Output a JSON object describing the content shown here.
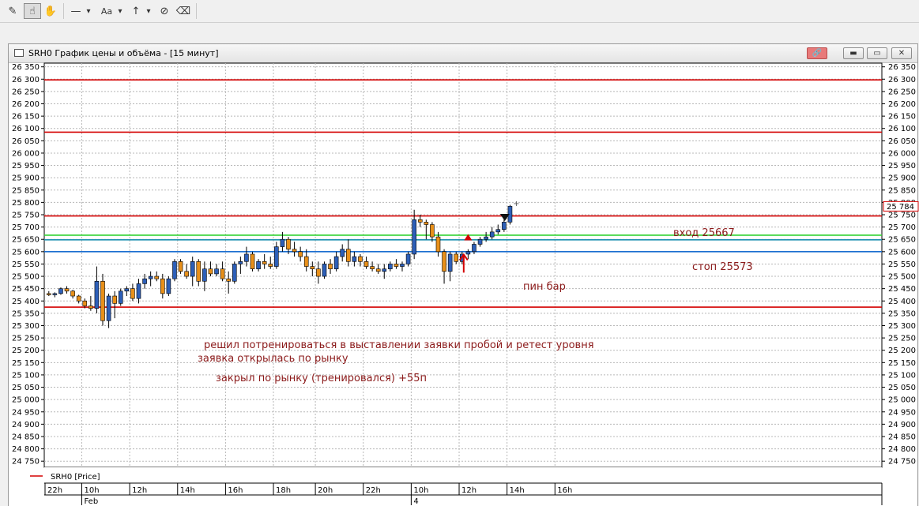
{
  "toolbar": {
    "items": [
      {
        "name": "ruler-icon",
        "glyph": "✎"
      },
      {
        "name": "hand-pointer-icon",
        "glyph": "☝"
      },
      {
        "name": "hand-grab-icon",
        "glyph": "✋"
      },
      {
        "name": "line-tool-icon",
        "glyph": "—"
      },
      {
        "name": "text-tool-icon",
        "glyph": "Aa"
      },
      {
        "name": "arrow-up-tool-icon",
        "glyph": "↑"
      },
      {
        "name": "hide-drawings-icon",
        "glyph": "⊘"
      },
      {
        "name": "erase-drawings-icon",
        "glyph": "⌫"
      }
    ],
    "dropdown_glyph": "▾"
  },
  "window": {
    "title": "SRH0 График цены и объёма - [15 минут]",
    "link_glyph": "🔗",
    "min_glyph": "▬",
    "max_glyph": "▭",
    "close_glyph": "✕"
  },
  "chart_data": {
    "type": "candlestick",
    "ylim": [
      24725,
      26365
    ],
    "ytick_step": 50,
    "y_ticks": [
      "26 350",
      "26 300",
      "26 250",
      "26 200",
      "26 150",
      "26 100",
      "26 050",
      "26 000",
      "25 950",
      "25 900",
      "25 850",
      "25 800",
      "25 750",
      "25 700",
      "25 650",
      "25 600",
      "25 550",
      "25 500",
      "25 450",
      "25 400",
      "25 350",
      "25 300",
      "25 250",
      "25 200",
      "25 150",
      "25 100",
      "25 050",
      "25 000",
      "24 950",
      "24 900",
      "24 850",
      "24 800",
      "24 750"
    ],
    "grid": true,
    "bar_count": 79,
    "x_time_labels": [
      {
        "bar": -2,
        "text": "22h"
      },
      {
        "bar": 6,
        "text": "10h"
      },
      {
        "bar": 14,
        "text": "12h"
      },
      {
        "bar": 22,
        "text": "14h"
      },
      {
        "bar": 30,
        "text": "16h"
      },
      {
        "bar": 38,
        "text": "18h"
      },
      {
        "bar": 45,
        "text": "20h"
      },
      {
        "bar": 53,
        "text": "22h"
      },
      {
        "bar": 61,
        "text": "10h"
      },
      {
        "bar": 69,
        "text": "12h"
      },
      {
        "bar": 77,
        "text": "14h"
      },
      {
        "bar": 85,
        "text": "16h"
      }
    ],
    "x_date_labels": [
      {
        "bar": 6,
        "text": "Feb"
      },
      {
        "bar": 61,
        "text": "4"
      }
    ],
    "candles": [
      [
        25430,
        25440,
        25420,
        25425
      ],
      [
        25425,
        25435,
        25415,
        25430
      ],
      [
        25430,
        25455,
        25425,
        25450
      ],
      [
        25450,
        25460,
        25430,
        25440
      ],
      [
        25440,
        25445,
        25410,
        25420
      ],
      [
        25420,
        25425,
        25390,
        25400
      ],
      [
        25400,
        25410,
        25370,
        25380
      ],
      [
        25380,
        25420,
        25360,
        25370
      ],
      [
        25370,
        25540,
        25350,
        25480
      ],
      [
        25480,
        25510,
        25300,
        25320
      ],
      [
        25320,
        25430,
        25290,
        25420
      ],
      [
        25420,
        25440,
        25330,
        25390
      ],
      [
        25390,
        25450,
        25380,
        25440
      ],
      [
        25440,
        25460,
        25420,
        25450
      ],
      [
        25450,
        25470,
        25400,
        25410
      ],
      [
        25410,
        25490,
        25390,
        25470
      ],
      [
        25470,
        25510,
        25450,
        25490
      ],
      [
        25490,
        25520,
        25460,
        25500
      ],
      [
        25500,
        25520,
        25480,
        25490
      ],
      [
        25490,
        25510,
        25410,
        25430
      ],
      [
        25430,
        25500,
        25420,
        25490
      ],
      [
        25490,
        25570,
        25480,
        25560
      ],
      [
        25560,
        25570,
        25510,
        25520
      ],
      [
        25520,
        25550,
        25490,
        25500
      ],
      [
        25500,
        25580,
        25460,
        25560
      ],
      [
        25560,
        25570,
        25460,
        25480
      ],
      [
        25480,
        25560,
        25440,
        25530
      ],
      [
        25530,
        25560,
        25500,
        25510
      ],
      [
        25510,
        25550,
        25500,
        25530
      ],
      [
        25530,
        25560,
        25480,
        25490
      ],
      [
        25490,
        25520,
        25430,
        25480
      ],
      [
        25480,
        25560,
        25470,
        25550
      ],
      [
        25550,
        25580,
        25510,
        25560
      ],
      [
        25560,
        25620,
        25540,
        25590
      ],
      [
        25590,
        25600,
        25520,
        25530
      ],
      [
        25530,
        25570,
        25520,
        25560
      ],
      [
        25560,
        25590,
        25530,
        25550
      ],
      [
        25550,
        25580,
        25530,
        25540
      ],
      [
        25540,
        25640,
        25530,
        25620
      ],
      [
        25620,
        25680,
        25600,
        25650
      ],
      [
        25650,
        25660,
        25590,
        25610
      ],
      [
        25610,
        25640,
        25580,
        25600
      ],
      [
        25600,
        25620,
        25560,
        25580
      ],
      [
        25580,
        25610,
        25520,
        25540
      ],
      [
        25540,
        25560,
        25500,
        25530
      ],
      [
        25530,
        25560,
        25470,
        25500
      ],
      [
        25500,
        25560,
        25490,
        25550
      ],
      [
        25550,
        25570,
        25510,
        25530
      ],
      [
        25530,
        25600,
        25520,
        25580
      ],
      [
        25580,
        25630,
        25560,
        25610
      ],
      [
        25610,
        25650,
        25540,
        25560
      ],
      [
        25560,
        25600,
        25540,
        25580
      ],
      [
        25580,
        25590,
        25540,
        25560
      ],
      [
        25560,
        25580,
        25530,
        25540
      ],
      [
        25540,
        25560,
        25520,
        25530
      ],
      [
        25530,
        25550,
        25510,
        25520
      ],
      [
        25520,
        25550,
        25490,
        25530
      ],
      [
        25530,
        25560,
        25520,
        25550
      ],
      [
        25550,
        25570,
        25530,
        25540
      ],
      [
        25540,
        25560,
        25520,
        25550
      ],
      [
        25550,
        25600,
        25540,
        25590
      ],
      [
        25590,
        25770,
        25570,
        25730
      ],
      [
        25730,
        25750,
        25700,
        25720
      ],
      [
        25720,
        25730,
        25650,
        25710
      ],
      [
        25710,
        25720,
        25640,
        25660
      ],
      [
        25660,
        25680,
        25580,
        25600
      ],
      [
        25600,
        25610,
        25470,
        25520
      ],
      [
        25520,
        25600,
        25480,
        25590
      ],
      [
        25590,
        25600,
        25550,
        25560
      ],
      [
        25560,
        25600,
        25550,
        25590
      ],
      [
        25590,
        25610,
        25570,
        25600
      ],
      [
        25600,
        25640,
        25590,
        25630
      ],
      [
        25630,
        25660,
        25620,
        25650
      ],
      [
        25650,
        25680,
        25640,
        25660
      ],
      [
        25660,
        25700,
        25650,
        25680
      ],
      [
        25680,
        25710,
        25670,
        25690
      ]
    ],
    "current_price": "25 784",
    "level_lines": [
      {
        "price": 26297,
        "color": "#d40000"
      },
      {
        "price": 26085,
        "color": "#d40000"
      },
      {
        "price": 25745,
        "color": "#d40000"
      },
      {
        "price": 25667,
        "color": "#2fd22f"
      },
      {
        "price": 25648,
        "color": "#1e90b0"
      },
      {
        "price": 25600,
        "color": "#1a6ed0"
      },
      {
        "price": 25375,
        "color": "#d40000"
      }
    ],
    "colors": {
      "up": "#2d5fb8",
      "down": "#e8901a",
      "grid": "#b8b8b8"
    },
    "legend_label": "SRH0 [Price]"
  },
  "annotations": {
    "entry": "вход 25667",
    "stop": "стоп 25573",
    "pinbar": "пин бар",
    "line1": "решил потренироваться в выставлении заявки пробой и ретест уровня",
    "line2": "заявка открылась по рынку",
    "line3": "закрыл  по рынку (тренировался) +55п"
  }
}
